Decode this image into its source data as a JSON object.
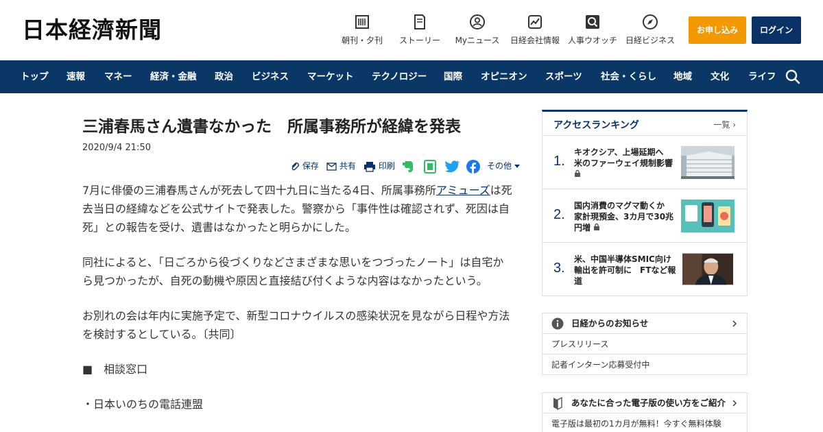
{
  "header": {
    "logo": "日本経濟新聞",
    "nav": [
      {
        "label": "朝刊・夕刊",
        "icon": "newspaper-icon"
      },
      {
        "label": "ストーリー",
        "icon": "story-icon"
      },
      {
        "label": "Myニュース",
        "icon": "user-icon"
      },
      {
        "label": "日経会社情報",
        "icon": "chart-icon"
      },
      {
        "label": "人事ウオッチ",
        "icon": "search-person-icon"
      },
      {
        "label": "日経ビジネス",
        "icon": "compass-icon"
      }
    ],
    "apply_label": "お申し込み",
    "login_label": "ログイン"
  },
  "categories": [
    "トップ",
    "速報",
    "マネー",
    "経済・金融",
    "政治",
    "ビジネス",
    "マーケット",
    "テクノロジー",
    "国際",
    "オピニオン",
    "スポーツ",
    "社会・くらし",
    "地域",
    "文化",
    "ライフ"
  ],
  "article": {
    "title": "三浦春馬さん遺書なかった　所属事務所が経緯を発表",
    "date": "2020/9/4 21:50",
    "share": {
      "save": "保存",
      "share": "共有",
      "print": "印刷",
      "more": "その他"
    },
    "p1_a": "7月に俳優の三浦春馬さんが死去して四十九日に当たる4日、所属事務所",
    "p1_link": "アミューズ",
    "p1_b": "は死去当日の経緯などを公式サイトで発表した。警察から「事件性は確認されず、死因は自死」との報告を受け、遺書はなかったと明らかにした。",
    "p2": "同社によると、「日ごろから役づくりなどさまざまな思いをつづったノート」は自宅から見つかったが、自死の動機や原因と直接結び付くような内容はなかったという。",
    "p3": "お別れの会は年内に実施予定で、新型コロナウイルスの感染状況を見ながら日程や方法を検討するとしている。〔共同〕",
    "p4": "■　相談窓口",
    "p5": "・日本いのちの電話連盟"
  },
  "ranking": {
    "title": "アクセスランキング",
    "all": "一覧",
    "items": [
      {
        "num": "1.",
        "text": "キオクシア、上場延期へ　米のファーウェイ規制影響"
      },
      {
        "num": "2.",
        "text": "国内消費のマグマ動くか　家計現預金、3カ月で30兆円増"
      },
      {
        "num": "3.",
        "text": "米、中国半導体SMIC向け輸出を許可制に　FTなど報道"
      }
    ]
  },
  "notice": {
    "title": "日経からのお知らせ",
    "items": [
      "プレスリリース",
      "記者インターン応募受付中"
    ]
  },
  "guide": {
    "title": "あなたに合った電子版の使い方をご紹介",
    "items": [
      "電子版は最初の1カ月が無料！今すぐ無料体験"
    ]
  },
  "colors": {
    "navy": "#0b3766",
    "orange": "#f39800",
    "evernote": "#2dbe60",
    "twitter": "#1da1f2",
    "facebook": "#1877f2"
  }
}
